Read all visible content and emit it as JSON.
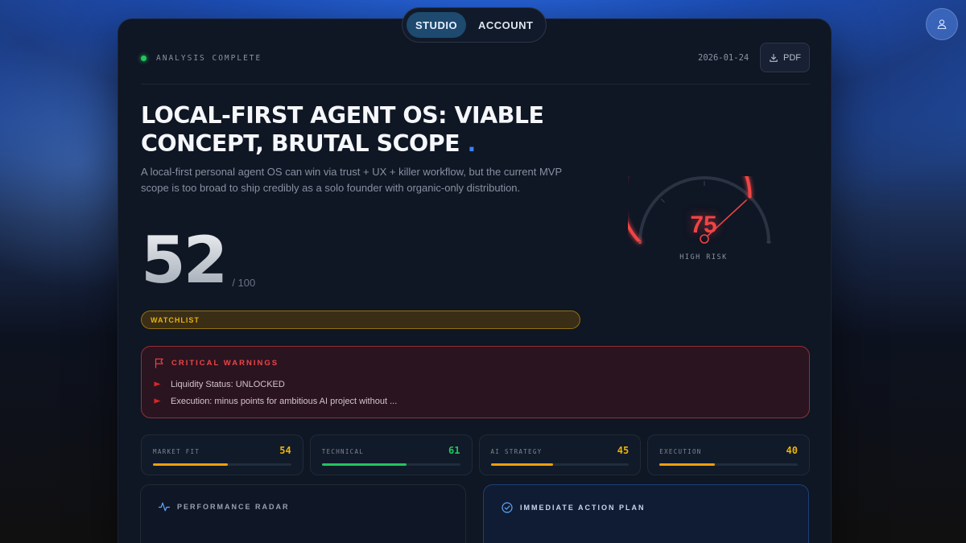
{
  "nav": {
    "tabs": [
      {
        "label": "STUDIO",
        "active": true
      },
      {
        "label": "ACCOUNT",
        "active": false
      }
    ],
    "avatar_icon": "user-icon"
  },
  "report": {
    "status": "ANALYSIS COMPLETE",
    "date": "2026-01-24",
    "pdf_label": "PDF",
    "title_line1": "LOCAL-FIRST AGENT OS: VIABLE",
    "title_line2": "CONCEPT, BRUTAL SCOPE",
    "title_dot": ".",
    "subtitle": "A local-first personal agent OS can win via trust + UX + killer workflow, but the current MVP scope is too broad to ship credibly as a solo founder with organic-only distribution.",
    "score": "52",
    "score_max": "/ 100",
    "badge": "WATCHLIST"
  },
  "gauge": {
    "value": 75,
    "max": 100,
    "label": "HIGH RISK",
    "color": "#ef4444"
  },
  "warnings": {
    "title": "CRITICAL WARNINGS",
    "items": [
      "Liquidity Status: UNLOCKED",
      "Execution: minus points for ambitious AI project without ..."
    ]
  },
  "metrics": [
    {
      "label": "MARKET FIT",
      "value": 54,
      "color": "#eab308",
      "bar": "#f59e0b"
    },
    {
      "label": "TECHNICAL",
      "value": 61,
      "color": "#22c55e",
      "bar": "#22c55e"
    },
    {
      "label": "AI STRATEGY",
      "value": 45,
      "color": "#eab308",
      "bar": "#f59e0b"
    },
    {
      "label": "EXECUTION",
      "value": 40,
      "color": "#eab308",
      "bar": "#f59e0b"
    }
  ],
  "cards": {
    "radar_title": "PERFORMANCE RADAR",
    "action_title": "IMMEDIATE ACTION PLAN"
  }
}
